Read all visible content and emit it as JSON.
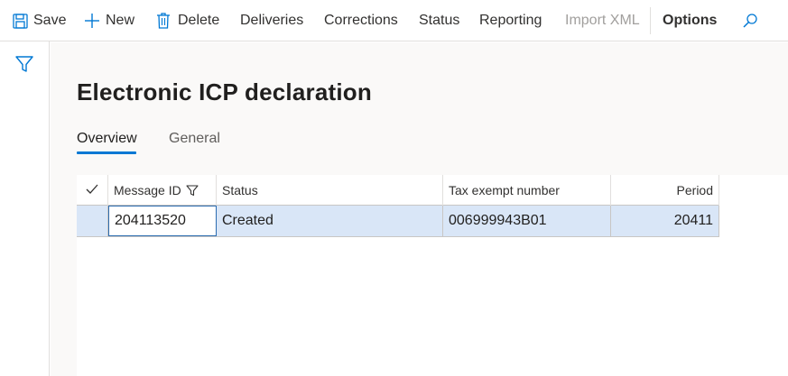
{
  "toolbar": {
    "save_label": "Save",
    "new_label": "New",
    "delete_label": "Delete",
    "deliveries_label": "Deliveries",
    "corrections_label": "Corrections",
    "status_label": "Status",
    "reporting_label": "Reporting",
    "import_xml_label": "Import XML",
    "options_label": "Options"
  },
  "page": {
    "title": "Electronic ICP declaration",
    "tabs": [
      {
        "label": "Overview"
      },
      {
        "label": "General"
      }
    ]
  },
  "grid": {
    "columns": [
      {
        "label": "Message ID"
      },
      {
        "label": "Status"
      },
      {
        "label": "Tax exempt number"
      },
      {
        "label": "Period"
      }
    ],
    "rows": [
      {
        "message_id": "204113520",
        "status": "Created",
        "tax_exempt_number": "006999943B01",
        "period": "20411"
      }
    ]
  },
  "colors": {
    "accent": "#0078d4",
    "selected_row": "#d9e6f7",
    "content_background": "#faf9f8",
    "disabled_text": "#a19f9d"
  }
}
